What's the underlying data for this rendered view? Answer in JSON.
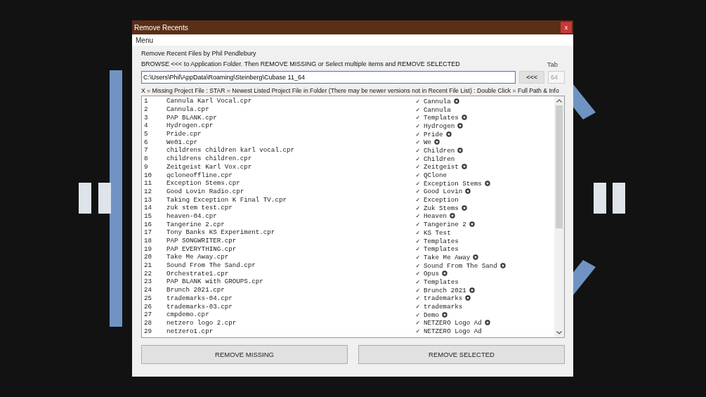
{
  "background": {
    "kind": "picture"
  },
  "window": {
    "title": "Remove Recents",
    "close": "x"
  },
  "menu": [
    "Menu"
  ],
  "credit": "Remove Recent Files by Phil Pendlebury",
  "instructions": "BROWSE <<< to Application Folder.  Then REMOVE MISSING or Select multiple items and REMOVE SELECTED",
  "path_field": {
    "value": "C:\\Users\\Phil\\AppData\\Roaming\\Steinberg\\Cubase 11_64"
  },
  "browse_button": "<<<",
  "tab_field": {
    "label": "Tab",
    "value": "64",
    "disabled": true
  },
  "legend": "X = Missing Project File : STAR = Newest Listed Project File in Folder (There may be newer versions not in Recent File List) : Double Click = Full Path & Info",
  "rows": [
    {
      "number": "1",
      "file": "Cannula Karl Vocal.cpr",
      "folder": "✓ Cannula",
      "star": true
    },
    {
      "number": "2",
      "file": "Cannula.cpr",
      "folder": "✓ Cannula",
      "star": false
    },
    {
      "number": "3",
      "file": "PAP BLANK.cpr",
      "folder": "✓ Templates",
      "star": true
    },
    {
      "number": "4",
      "file": "Hydrogen.cpr",
      "folder": "✓ Hydrogen",
      "star": true
    },
    {
      "number": "5",
      "file": "Pride.cpr",
      "folder": "✓ Pride",
      "star": true
    },
    {
      "number": "6",
      "file": "We01.cpr",
      "folder": "✓ We",
      "star": true
    },
    {
      "number": "7",
      "file": "childrens children karl vocal.cpr",
      "folder": "✓ Children",
      "star": true
    },
    {
      "number": "8",
      "file": "childrens children.cpr",
      "folder": "✓ Children",
      "star": false
    },
    {
      "number": "9",
      "file": "Zeitgeist Karl Vox.cpr",
      "folder": "✓ Zeitgeist",
      "star": true
    },
    {
      "number": "10",
      "file": "qcloneoffline.cpr",
      "folder": "✓ QClone",
      "star": false
    },
    {
      "number": "11",
      "file": "Exception Stems.cpr",
      "folder": "✓ Exception Stems",
      "star": true
    },
    {
      "number": "12",
      "file": "Good Lovin Radio.cpr",
      "folder": "✓ Good Lovin",
      "star": true
    },
    {
      "number": "13",
      "file": "Taking Exception K Final TV.cpr",
      "folder": "✓ Exception",
      "star": false
    },
    {
      "number": "14",
      "file": "zuk stem test.cpr",
      "folder": "✓ Zuk Stems",
      "star": true
    },
    {
      "number": "15",
      "file": "heaven-04.cpr",
      "folder": "✓ Heaven",
      "star": true
    },
    {
      "number": "16",
      "file": "Tangerine 2.cpr",
      "folder": "✓ Tangerine 2",
      "star": true
    },
    {
      "number": "17",
      "file": "Tony Banks KS Experiment.cpr",
      "folder": "✓ KS Test",
      "star": false
    },
    {
      "number": "18",
      "file": "PAP SONGWRITER.cpr",
      "folder": "✓ Templates",
      "star": false
    },
    {
      "number": "19",
      "file": "PAP EVERYTHING.cpr",
      "folder": "✓ Templates",
      "star": false
    },
    {
      "number": "20",
      "file": "Take Me Away.cpr",
      "folder": "✓ Take Me Away",
      "star": true
    },
    {
      "number": "21",
      "file": "Sound From The Sand.cpr",
      "folder": "✓ Sound From The Sand",
      "star": true
    },
    {
      "number": "22",
      "file": "Orchestrate1.cpr",
      "folder": "✓ Opus",
      "star": true
    },
    {
      "number": "23",
      "file": "PAP BLANK with GROUPS.cpr",
      "folder": "✓ Templates",
      "star": false
    },
    {
      "number": "24",
      "file": "Brunch 2021.cpr",
      "folder": "✓ Brunch 2021",
      "star": true
    },
    {
      "number": "25",
      "file": "trademarks-04.cpr",
      "folder": "✓ trademarks",
      "star": true
    },
    {
      "number": "26",
      "file": "trademarks-03.cpr",
      "folder": "✓ trademarks",
      "star": false
    },
    {
      "number": "27",
      "file": "cmpdemo.cpr",
      "folder": "✓ Demo",
      "star": true
    },
    {
      "number": "28",
      "file": "netzero logo 2.cpr",
      "folder": "✓ NETZERO Logo Ad",
      "star": true
    },
    {
      "number": "29",
      "file": "netzero1.cpr",
      "folder": "✓ NETZERO Logo Ad",
      "star": false
    }
  ],
  "buttons": [
    "REMOVE MISSING",
    "REMOVE SELECTED"
  ]
}
